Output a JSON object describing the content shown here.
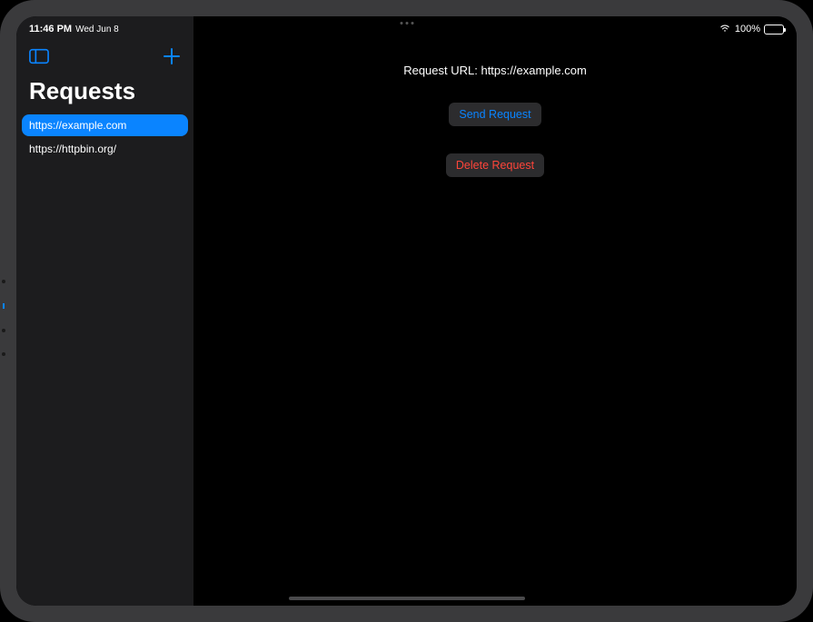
{
  "status": {
    "time": "11:46 PM",
    "date": "Wed Jun 8",
    "battery": "100%"
  },
  "sidebar": {
    "title": "Requests",
    "items": [
      {
        "label": "https://example.com",
        "selected": true
      },
      {
        "label": "https://httpbin.org/",
        "selected": false
      }
    ]
  },
  "main": {
    "url_prefix": "Request URL: ",
    "url_value": "https://example.com",
    "send_label": "Send Request",
    "delete_label": "Delete Request"
  }
}
